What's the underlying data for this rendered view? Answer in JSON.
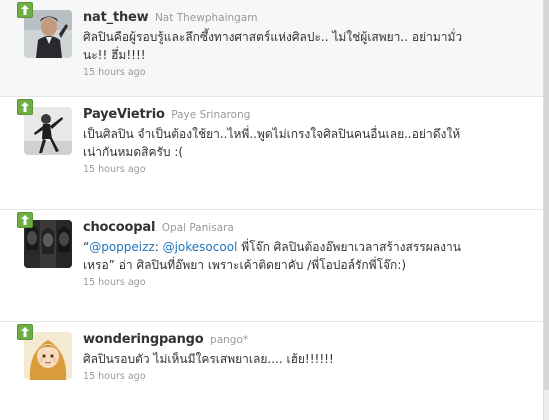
{
  "tweets": [
    {
      "screen_name": "nat_thew",
      "full_name": "Nat Thewphaingam",
      "text_lines": [
        "ศิลปินคือผู้รอบรู้และลึกซึ้งทางศาสตร์แห่งศิลปะ.. ไม่ใช่ผู้เสพยา.. อย่ามามั่ว",
        "นะ!! ฮึ่ม!!!!"
      ],
      "time": "15 hours ago",
      "avatar": "man-in-suit-photo"
    },
    {
      "screen_name": "PayeVietrio",
      "full_name": "Paye Srinarong",
      "text_lines": [
        "เป็นศิลปิน จำเป็นต้องใช้ยา..ไหพี่..พูดไม่เกรงใจศิลปินคนอื่นเลย..อย่าดึงให้",
        "เน่ากันหมดสิครับ :("
      ],
      "time": "15 hours ago",
      "avatar": "dancer-black-and-white-photo"
    },
    {
      "screen_name": "chocoopal",
      "full_name": "Opal Panisara",
      "text_parts": {
        "open_quote": "“",
        "mention_1": "@poppeizz",
        "sep": ": ",
        "mention_2": "@jokesocool",
        "rest_line_1": " พี่โจ๊ก ศิลปินต้องอ๊พยาเวลาสร้างสรรผลงาน",
        "line_2": "เหรอ” อ่า ศิลปินที่อ๊พยา เพราะเค้าติดยาคับ /พี่โอปอล์รักพี่โจ๊ก:)"
      },
      "time": "15 hours ago",
      "avatar": "portrait-collage-photo"
    },
    {
      "screen_name": "wonderingpango",
      "full_name": "pango*",
      "text_lines": [
        "ศิลปินรอบตัว ไม่เห็นมีใครเสพยาเลย.... เฮ้ย!!!!!!"
      ],
      "time": "15 hours ago",
      "avatar": "cartoon-girl-illustration"
    }
  ],
  "colors": {
    "retweet_badge": "#6fae43",
    "mention": "#2276bb",
    "screen_name": "#333333",
    "meta": "#999999"
  },
  "icons": {
    "retweet_badge": "retweet-arrow-icon"
  }
}
